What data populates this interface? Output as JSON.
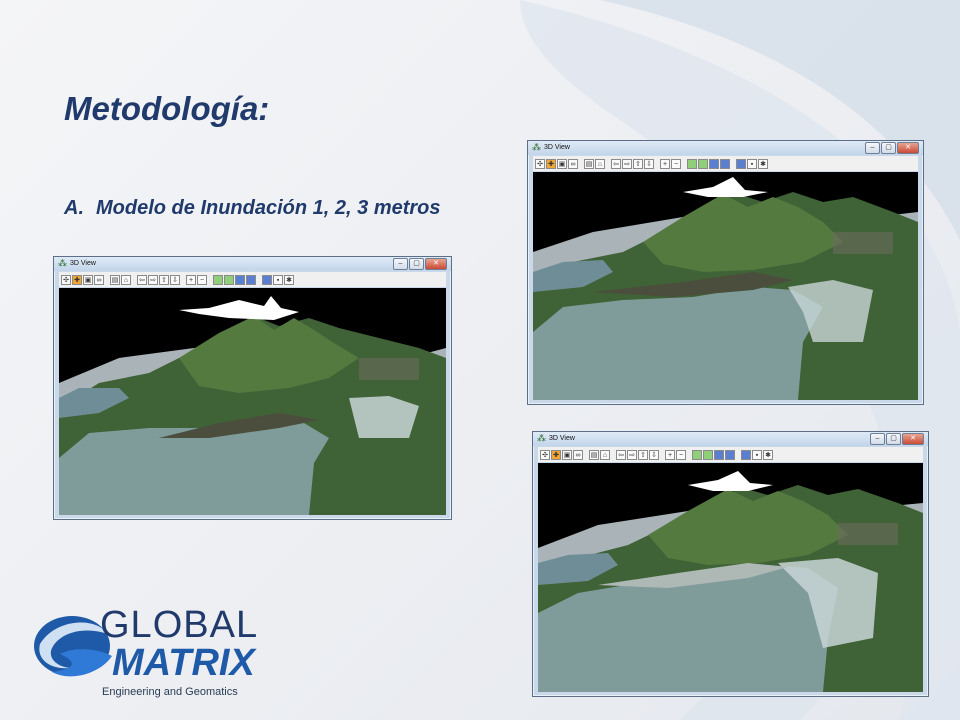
{
  "slide": {
    "title": "Metodología:",
    "item_marker": "A.",
    "item_text": "Modelo de Inundación 1, 2, 3 metros"
  },
  "windows": [
    {
      "title": "3D View",
      "flood_level_m": 1
    },
    {
      "title": "3D View",
      "flood_level_m": 2
    },
    {
      "title": "3D View",
      "flood_level_m": 3
    }
  ],
  "window_controls": {
    "minimize": "–",
    "maximize": "▢",
    "close": "✕"
  },
  "toolbar_icons": [
    "pan-icon",
    "move-icon",
    "copy-icon",
    "binoculars-icon",
    "print-icon",
    "home-icon",
    "back-arrow-icon",
    "forward-arrow-icon",
    "up-arrow-icon",
    "down-arrow-icon",
    "zoom-in-icon",
    "zoom-out-icon",
    "chart-icon",
    "chart-icon",
    "layer-icon",
    "layer-icon",
    "map-icon",
    "save-icon",
    "settings-icon"
  ],
  "logo": {
    "line1": "GLOBAL",
    "line2": "MATRIX",
    "line3": "Engineering and Geomatics"
  },
  "colors": {
    "title": "#1f3a6b",
    "water": "#7f9c9a",
    "terrain": "#4a6a3a",
    "sky": "#000000"
  }
}
